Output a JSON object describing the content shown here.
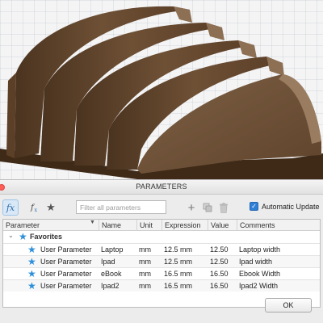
{
  "dialog": {
    "title": "PARAMETERS",
    "toolbar": {
      "filter_placeholder": "Filter all parameters",
      "auto_update_label": "Automatic Update",
      "auto_update_checked": true
    },
    "table": {
      "columns": [
        "Parameter",
        "Name",
        "Unit",
        "Expression",
        "Value",
        "Comments"
      ],
      "group_label": "Favorites",
      "rows": [
        {
          "parameter": "User Parameter",
          "name": "Laptop",
          "unit": "mm",
          "expression": "12.5 mm",
          "value": "12.50",
          "comment": "Laptop width"
        },
        {
          "parameter": "User Parameter",
          "name": "Ipad",
          "unit": "mm",
          "expression": "12.5 mm",
          "value": "12.50",
          "comment": "Ipad width"
        },
        {
          "parameter": "User Parameter",
          "name": "eBook",
          "unit": "mm",
          "expression": "16.5 mm",
          "value": "16.50",
          "comment": "Ebook Width"
        },
        {
          "parameter": "User Parameter",
          "name": "Ipad2",
          "unit": "mm",
          "expression": "16.5 mm",
          "value": "16.50",
          "comment": "Ipad2 Width"
        }
      ]
    },
    "ok_label": "OK"
  },
  "icons": {
    "fx": "fx-icon",
    "user_fx": "user-fx-icon",
    "favorite": "star-icon",
    "add": "plus-icon",
    "copy": "copy-icon",
    "delete": "trash-icon"
  },
  "colors": {
    "model_wood": "#6b4a2f",
    "accent_blue": "#2d8fd9",
    "close_red": "#ff5f57"
  }
}
